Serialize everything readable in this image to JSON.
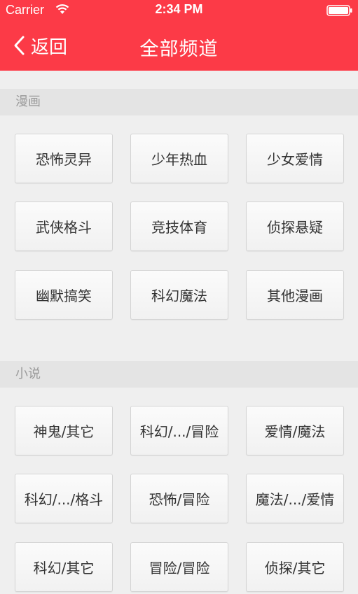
{
  "status_bar": {
    "carrier": "Carrier",
    "time": "2:34 PM"
  },
  "nav": {
    "back_label": "返回",
    "title": "全部频道"
  },
  "colors": {
    "header_bg": "#fc3a47",
    "section_bg": "#e4e4e4",
    "page_bg": "#efefef"
  },
  "sections": [
    {
      "title": "漫画",
      "items": [
        "恐怖灵异",
        "少年热血",
        "少女爱情",
        "武侠格斗",
        "竞技体育",
        "侦探悬疑",
        "幽默搞笑",
        "科幻魔法",
        "其他漫画"
      ]
    },
    {
      "title": "小说",
      "items": [
        "神鬼/其它",
        "科幻/.../冒险",
        "爱情/魔法",
        "科幻/.../格斗",
        "恐怖/冒险",
        "魔法/.../爱情",
        "科幻/其它",
        "冒险/冒险",
        "侦探/其它"
      ]
    }
  ]
}
